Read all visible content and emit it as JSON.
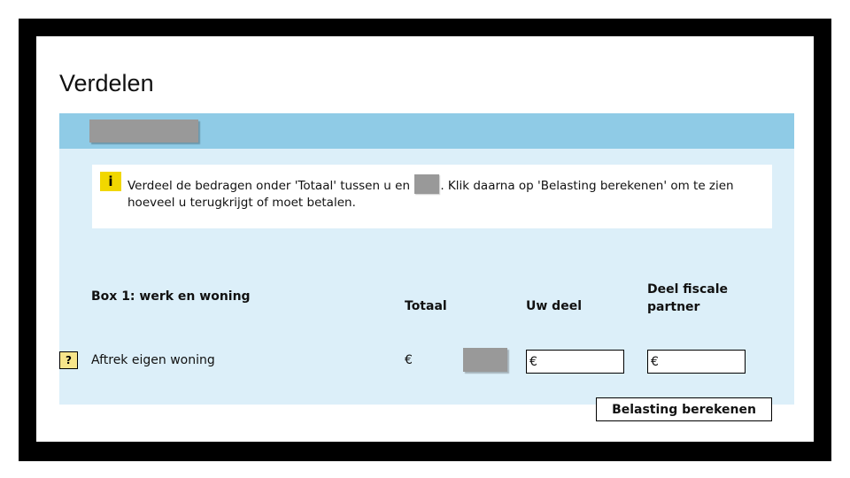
{
  "page": {
    "title": "Verdelen"
  },
  "info": {
    "icon": "info-icon",
    "text_before": "Verdeel de bedragen onder 'Totaal' tussen u en",
    "text_after": ". Klik daarna op 'Belasting berekenen' om te zien hoeveel u terugkrijgt of moet betalen."
  },
  "columns": {
    "total": "Totaal",
    "own_share": "Uw deel",
    "partner_share_line1": "Deel fiscale",
    "partner_share_line2": "partner"
  },
  "section": {
    "heading": "Box 1: werk en woning"
  },
  "row": {
    "help_label": "?",
    "label": "Aftrek eigen woning",
    "currency_symbol": "€",
    "own_share_value": "",
    "partner_share_value": ""
  },
  "actions": {
    "calculate_label": "Belasting berekenen"
  },
  "colors": {
    "band": "#8fcbe6",
    "panel": "#dceff9",
    "info_icon": "#f1d700",
    "help_button": "#f7e58a"
  }
}
